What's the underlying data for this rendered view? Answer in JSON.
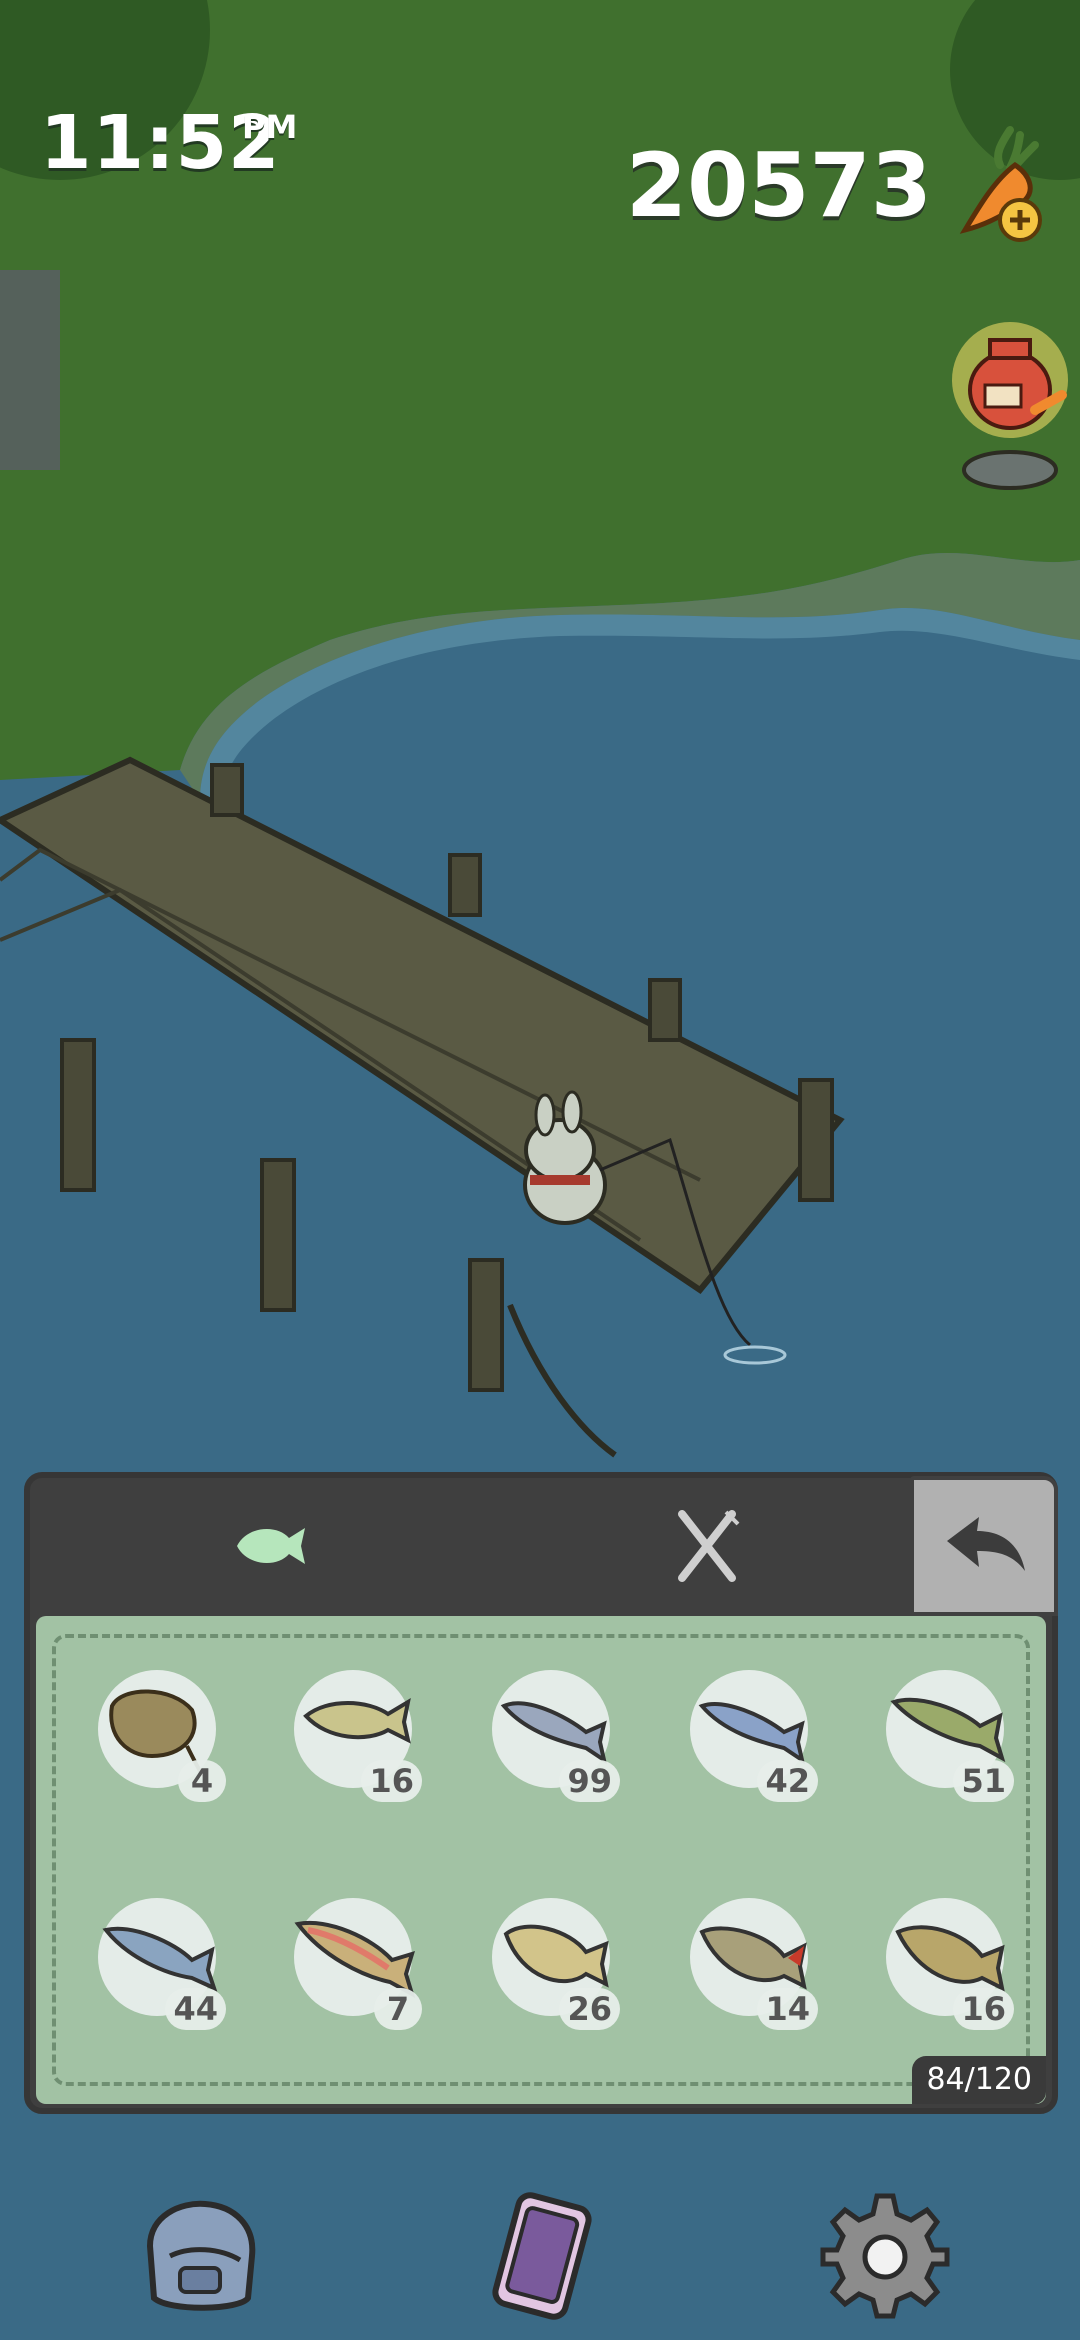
{
  "status": {
    "time": "11:52",
    "suffix": "PM"
  },
  "currency": {
    "value": "20573",
    "icon": "carrot-plus-icon"
  },
  "reward": {
    "icon": "lucky-bag-icon"
  },
  "panel": {
    "tabs": [
      {
        "icon": "fish-icon",
        "active": true
      },
      {
        "icon": "fork-knife-icon",
        "active": false
      }
    ],
    "back_icon": "back-arrow-icon",
    "capacity": "84/120",
    "slots": [
      {
        "fish": "stingray",
        "count": "4"
      },
      {
        "fish": "yellow-fish",
        "count": "16"
      },
      {
        "fish": "silver-fish",
        "count": "99"
      },
      {
        "fish": "blue-fish",
        "count": "42"
      },
      {
        "fish": "spotted-green-fish",
        "count": "51"
      },
      {
        "fish": "mackerel",
        "count": "44"
      },
      {
        "fish": "rainbow-trout",
        "count": "7"
      },
      {
        "fish": "round-yellow-fish",
        "count": "26"
      },
      {
        "fish": "red-fin-fish",
        "count": "14"
      },
      {
        "fish": "carp",
        "count": "16"
      }
    ]
  },
  "nav": [
    {
      "icon": "backpack-icon"
    },
    {
      "icon": "phone-icon"
    },
    {
      "icon": "gear-icon"
    }
  ],
  "colors": {
    "grass": "#40702e",
    "water": "#3a6a86",
    "panel": "#3f3f3f",
    "inventory": "#a2c2a4",
    "accent_fish": "#b6e6bc"
  }
}
